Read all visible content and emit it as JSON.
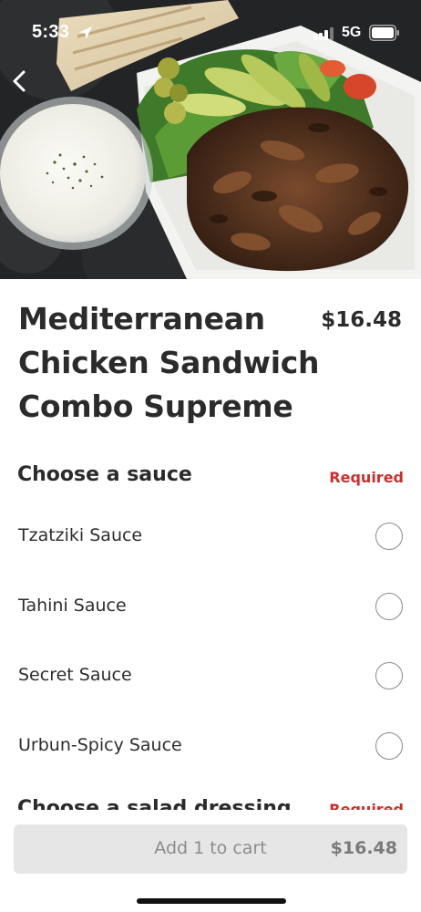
{
  "status_bar": {
    "time": "5:33",
    "network": "5G",
    "icons": [
      "location-arrow-icon",
      "signal-icon",
      "battery-icon"
    ]
  },
  "nav": {
    "back_icon": "chevron-left-icon"
  },
  "item": {
    "title": "Mediterranean Chicken Sandwich Combo Supreme",
    "price": "$16.48"
  },
  "sauce_section": {
    "title": "Choose a sauce",
    "badge": "Required",
    "options": [
      {
        "label": "Tzatziki Sauce",
        "selected": false
      },
      {
        "label": "Tahini Sauce",
        "selected": false
      },
      {
        "label": "Secret Sauce",
        "selected": false
      },
      {
        "label": "Urbun-Spicy Sauce",
        "selected": false
      }
    ]
  },
  "dressing_section": {
    "title": "Choose a salad dressing",
    "badge": "Required"
  },
  "cart": {
    "label": "Add 1 to cart",
    "price": "$16.48"
  },
  "colors": {
    "required": "#c9302c",
    "cart_button_bg": "#e6e6e6",
    "text": "#2b2b2b"
  }
}
